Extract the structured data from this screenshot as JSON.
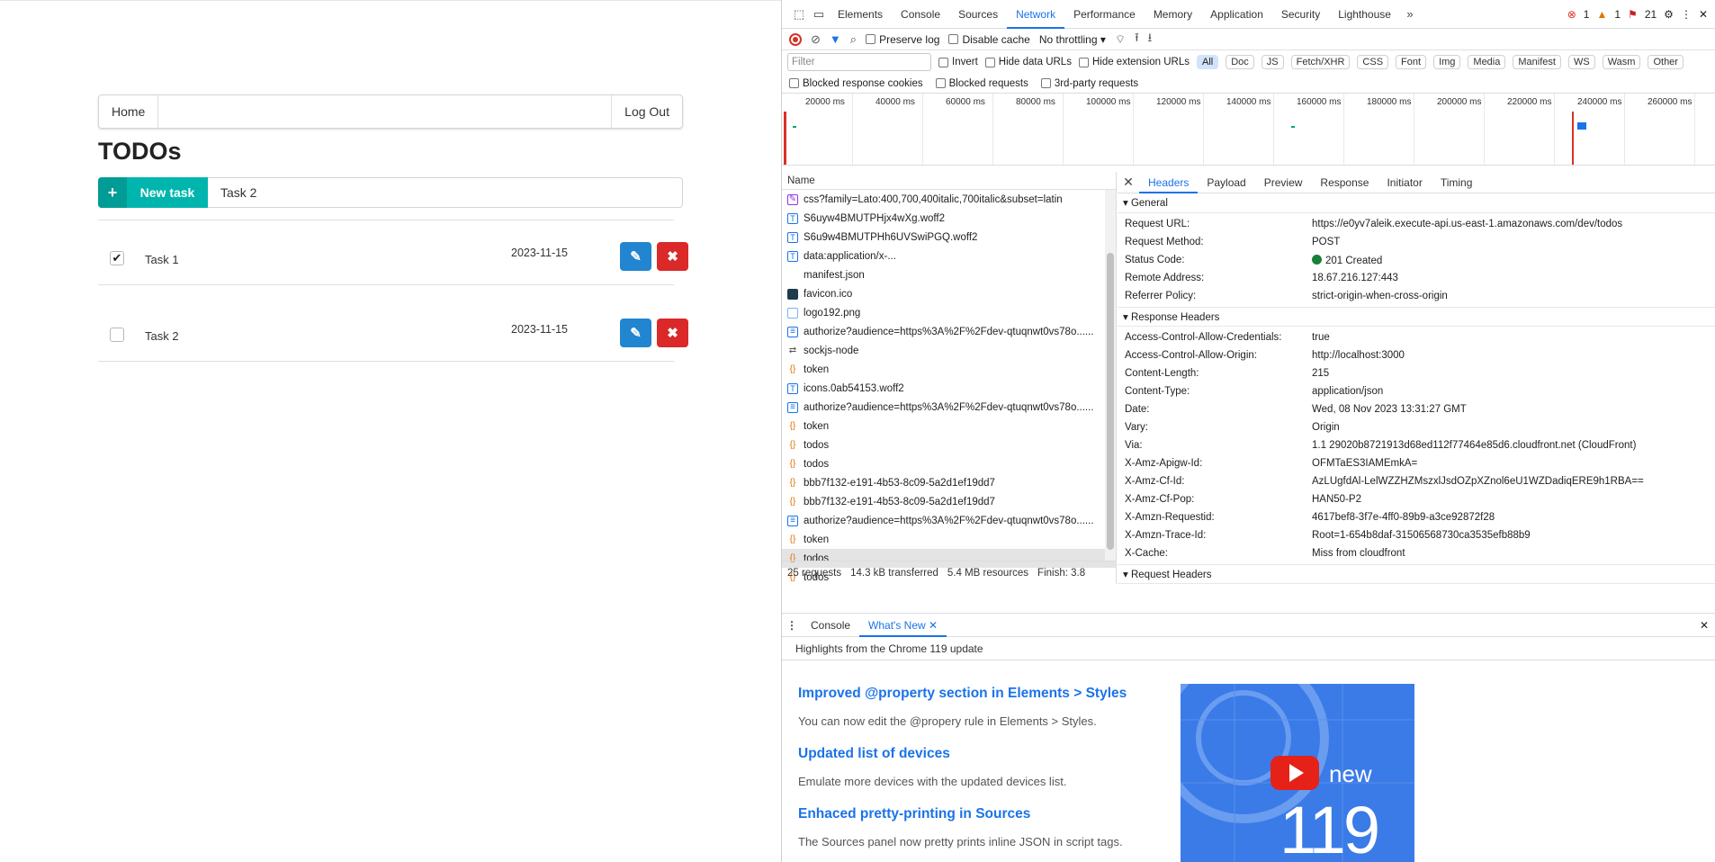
{
  "app": {
    "nav": {
      "home": "Home",
      "logout": "Log Out"
    },
    "title": "TODOs",
    "new_task_label": "New task",
    "new_task_input": "Task 2",
    "tasks": [
      {
        "name": "Task 1",
        "date": "2023-11-15",
        "done": true
      },
      {
        "name": "Task 2",
        "date": "2023-11-15",
        "done": false
      }
    ]
  },
  "devtools": {
    "tabs": [
      "Elements",
      "Console",
      "Sources",
      "Network",
      "Performance",
      "Memory",
      "Application",
      "Security",
      "Lighthouse"
    ],
    "active_tab": "Network",
    "badges": {
      "errors": "1",
      "warnings": "1",
      "issues": "21"
    },
    "toolbar": {
      "preserve_log": "Preserve log",
      "disable_cache": "Disable cache",
      "throttling": "No throttling"
    },
    "filter": {
      "placeholder": "Filter",
      "invert": "Invert",
      "hide_data_urls": "Hide data URLs",
      "hide_ext_urls": "Hide extension URLs",
      "types": [
        "All",
        "Doc",
        "JS",
        "Fetch/XHR",
        "CSS",
        "Font",
        "Img",
        "Media",
        "Manifest",
        "WS",
        "Wasm",
        "Other"
      ],
      "blocked_cookies": "Blocked response cookies",
      "blocked_requests": "Blocked requests",
      "third_party": "3rd-party requests"
    },
    "timeline_ticks": [
      "20000 ms",
      "40000 ms",
      "60000 ms",
      "80000 ms",
      "100000 ms",
      "120000 ms",
      "140000 ms",
      "160000 ms",
      "180000 ms",
      "200000 ms",
      "220000 ms",
      "240000 ms",
      "260000 ms"
    ],
    "requests_header": "Name",
    "requests": [
      {
        "name": "css?family=Lato:400,700,400italic,700italic&subset=latin",
        "icon": "css"
      },
      {
        "name": "S6uyw4BMUTPHjx4wXg.woff2",
        "icon": "font"
      },
      {
        "name": "S6u9w4BMUTPHh6UVSwiPGQ.woff2",
        "icon": "font"
      },
      {
        "name": "data:application/x-...",
        "icon": "font"
      },
      {
        "name": "manifest.json",
        "icon": "none"
      },
      {
        "name": "favicon.ico",
        "icon": "fav"
      },
      {
        "name": "logo192.png",
        "icon": "img"
      },
      {
        "name": "authorize?audience=https%3A%2F%2Fdev-qtuqnwt0vs78o......",
        "icon": "doc"
      },
      {
        "name": "sockjs-node",
        "icon": "ws"
      },
      {
        "name": "token",
        "icon": "fetch"
      },
      {
        "name": "icons.0ab54153.woff2",
        "icon": "font"
      },
      {
        "name": "authorize?audience=https%3A%2F%2Fdev-qtuqnwt0vs78o......",
        "icon": "doc"
      },
      {
        "name": "token",
        "icon": "fetch"
      },
      {
        "name": "todos",
        "icon": "fetch"
      },
      {
        "name": "todos",
        "icon": "fetch"
      },
      {
        "name": "bbb7f132-e191-4b53-8c09-5a2d1ef19dd7",
        "icon": "fetch"
      },
      {
        "name": "bbb7f132-e191-4b53-8c09-5a2d1ef19dd7",
        "icon": "fetch"
      },
      {
        "name": "authorize?audience=https%3A%2F%2Fdev-qtuqnwt0vs78o......",
        "icon": "doc"
      },
      {
        "name": "token",
        "icon": "fetch"
      },
      {
        "name": "todos",
        "icon": "fetch",
        "selected": true
      },
      {
        "name": "todos",
        "icon": "fetch"
      }
    ],
    "status": {
      "requests": "25 requests",
      "transferred": "14.3 kB transferred",
      "resources": "5.4 MB resources",
      "finish": "Finish: 3.8"
    },
    "detail_tabs": [
      "Headers",
      "Payload",
      "Preview",
      "Response",
      "Initiator",
      "Timing"
    ],
    "general_title": "General",
    "general": [
      {
        "k": "Request URL:",
        "v": "https://e0yv7aleik.execute-api.us-east-1.amazonaws.com/dev/todos"
      },
      {
        "k": "Request Method:",
        "v": "POST"
      },
      {
        "k": "Status Code:",
        "v": "201 Created",
        "status": true
      },
      {
        "k": "Remote Address:",
        "v": "18.67.216.127:443"
      },
      {
        "k": "Referrer Policy:",
        "v": "strict-origin-when-cross-origin"
      }
    ],
    "response_title": "Response Headers",
    "response": [
      {
        "k": "Access-Control-Allow-Credentials:",
        "v": "true"
      },
      {
        "k": "Access-Control-Allow-Origin:",
        "v": "http://localhost:3000"
      },
      {
        "k": "Content-Length:",
        "v": "215"
      },
      {
        "k": "Content-Type:",
        "v": "application/json"
      },
      {
        "k": "Date:",
        "v": "Wed, 08 Nov 2023 13:31:27 GMT"
      },
      {
        "k": "Vary:",
        "v": "Origin"
      },
      {
        "k": "Via:",
        "v": "1.1 29020b8721913d68ed112f77464e85d6.cloudfront.net (CloudFront)"
      },
      {
        "k": "X-Amz-Apigw-Id:",
        "v": "OFMTaES3IAMEmkA="
      },
      {
        "k": "X-Amz-Cf-Id:",
        "v": "AzLUgfdAl-LelWZZHZMszxlJsdOZpXZnol6eU1WZDadiqERE9h1RBA=="
      },
      {
        "k": "X-Amz-Cf-Pop:",
        "v": "HAN50-P2"
      },
      {
        "k": "X-Amzn-Requestid:",
        "v": "4617bef8-3f7e-4ff0-89b9-a3ce92872f28"
      },
      {
        "k": "X-Amzn-Trace-Id:",
        "v": "Root=1-654b8daf-31506568730ca3535efb88b9"
      },
      {
        "k": "X-Cache:",
        "v": "Miss from cloudfront"
      }
    ],
    "request_title": "Request Headers",
    "drawer": {
      "tabs": [
        "Console",
        "What's New"
      ],
      "active": "What's New",
      "subtitle": "Highlights from the Chrome 119 update",
      "items": [
        {
          "title": "Improved @property section in Elements > Styles",
          "desc": "You can now edit the @propery rule in Elements > Styles."
        },
        {
          "title": "Updated list of devices",
          "desc": "Emulate more devices with the updated devices list."
        },
        {
          "title": "Enhaced pretty-printing in Sources",
          "desc": "The Sources panel now pretty prints inline JSON in script tags."
        }
      ],
      "thumb_new": "new",
      "thumb_num": "119"
    }
  }
}
